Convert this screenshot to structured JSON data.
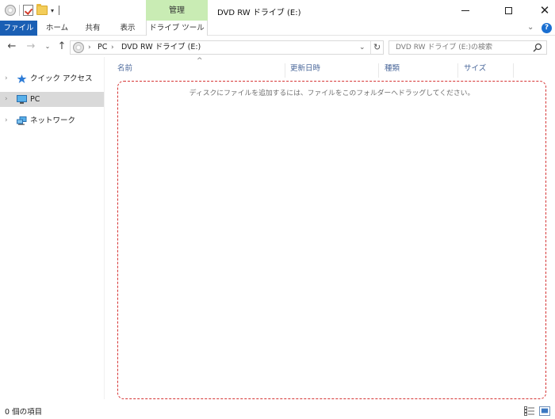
{
  "window": {
    "title": "DVD RW ドライブ (E:)",
    "context_tab_group": "管理",
    "minimize_glyph": "—",
    "close_glyph": "✕"
  },
  "quick_access_toolbar": {
    "icons": [
      "disc-icon",
      "properties-icon",
      "new-folder-icon",
      "customize-dropdown-icon"
    ],
    "dropdown_glyph": "▾"
  },
  "ribbon": {
    "tabs": [
      "ファイル",
      "ホーム",
      "共有",
      "表示",
      "ドライブ ツール"
    ],
    "collapse_glyph": "⌄",
    "help_glyph": "?"
  },
  "navigation": {
    "back_glyph": "←",
    "forward_glyph": "→",
    "recent_glyph": "⌄",
    "up_glyph": "↑"
  },
  "address_bar": {
    "breadcrumbs": [
      "PC",
      "DVD RW ドライブ (E:)"
    ],
    "separator": "›",
    "dropdown_glyph": "⌄",
    "refresh_glyph": "↻"
  },
  "search": {
    "placeholder": "DVD RW ドライブ (E:)の検索"
  },
  "nav_pane": {
    "expand_glyph": "›",
    "items": [
      {
        "label": "クイック アクセス",
        "icon": "star-icon",
        "selected": false
      },
      {
        "label": "PC",
        "icon": "computer-icon",
        "selected": true
      },
      {
        "label": "ネットワーク",
        "icon": "network-icon",
        "selected": false
      }
    ]
  },
  "file_list": {
    "sort_indicator": "^",
    "columns": [
      "名前",
      "更新日時",
      "種類",
      "サイズ"
    ],
    "empty_message": "ディスクにファイルを追加するには、ファイルをこのフォルダーへドラッグしてください。"
  },
  "status_bar": {
    "item_count": "0 個の項目"
  },
  "colors": {
    "file_tab": "#1a5fb4",
    "manage_tab": "#c9ecb4",
    "selected_nav": "#d9d9d9",
    "dropzone_border": "#d63434",
    "column_header_text": "#4d6a9c"
  }
}
